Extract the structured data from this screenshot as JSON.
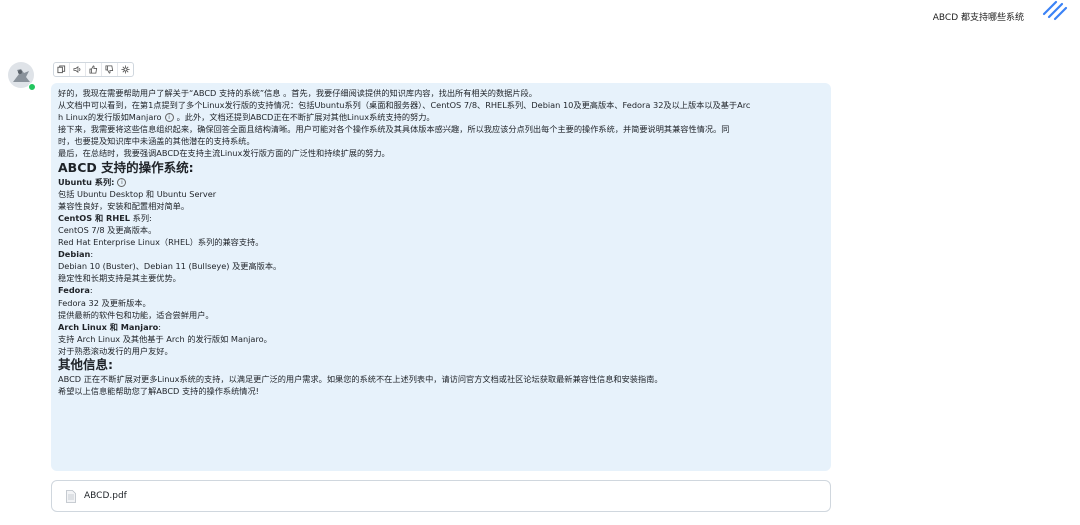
{
  "user_message": {
    "text": "ABCD 都支持哪些系统"
  },
  "toolbar": {
    "icons": [
      "copy-icon",
      "speaker-icon",
      "thumbs-up-icon",
      "thumbs-down-icon",
      "sparkle-icon"
    ]
  },
  "answer": {
    "intro": [
      "好的，我现在需要帮助用户了解关于“ABCD 支持的系统”信息 。首先，我要仔细阅读提供的知识库内容，找出所有相关的数据片段。",
      "从文档中可以看到，在第1点提到了多个Linux发行版的支持情况：包括Ubuntu系列（桌面和服务器）、CentOS 7/8、RHEL系列、Debian 10及更高版本、Fedora 32及以上版本以及基于Arc",
      "h Linux的发行版如Manjaro",
      "。此外，文档还提到ABCD正在不断扩展对其他Linux系统支持的努力。",
      "接下来，我需要将这些信息组织起来，确保回答全面且结构清晰。用户可能对各个操作系统及其具体版本感兴趣，所以我应该分点列出每个主要的操作系统，并简要说明其兼容性情况。同",
      "时，也要提及知识库中未涵盖的其他潜在的支持系统。",
      "最后，在总结时，我要强调ABCD在支持主流Linux发行版方面的广泛性和持续扩展的努力。"
    ],
    "heading_supported": "ABCD 支持的操作系统:",
    "ubuntu": {
      "title": "Ubuntu 系列:",
      "lines": [
        "包括 Ubuntu Desktop 和 Ubuntu Server",
        "兼容性良好，安装和配置相对简单。"
      ]
    },
    "centos": {
      "title": "CentOS 和 RHEL",
      "title_suffix": " 系列:",
      "lines": [
        "CentOS 7/8 及更高版本。",
        "Red Hat Enterprise Linux（RHEL）系列的兼容支持。"
      ]
    },
    "debian": {
      "title": "Debian",
      "title_suffix": ":",
      "lines": [
        "Debian 10 (Buster)、Debian 11 (Bullseye) 及更高版本。",
        "稳定性和长期支持是其主要优势。"
      ]
    },
    "fedora": {
      "title": "Fedora",
      "title_suffix": ":",
      "lines": [
        "Fedora 32 及更新版本。",
        "提供最新的软件包和功能，适合尝鲜用户。"
      ]
    },
    "arch": {
      "title": "Arch Linux 和 Manjaro",
      "title_suffix": ":",
      "lines": [
        "支持 Arch Linux 及其他基于 Arch 的发行版如 Manjaro。",
        "对于熟悉滚动发行的用户友好。"
      ]
    },
    "heading_other": "其他信息:",
    "closing": [
      "ABCD 正在不断扩展对更多Linux系统的支持，以满足更广泛的用户需求。如果您的系统不在上述列表中，请访问官方文档或社区论坛获取最新兼容性信息和安装指南。",
      "希望以上信息能帮助您了解ABCD 支持的操作系统情况!"
    ]
  },
  "attachment": {
    "filename": "ABCD.pdf",
    "icon": "file-icon"
  },
  "colors": {
    "bubble_bg": "#e7f2fb",
    "online_dot": "#22c55e",
    "brand_stripes": "#3b82f6"
  }
}
